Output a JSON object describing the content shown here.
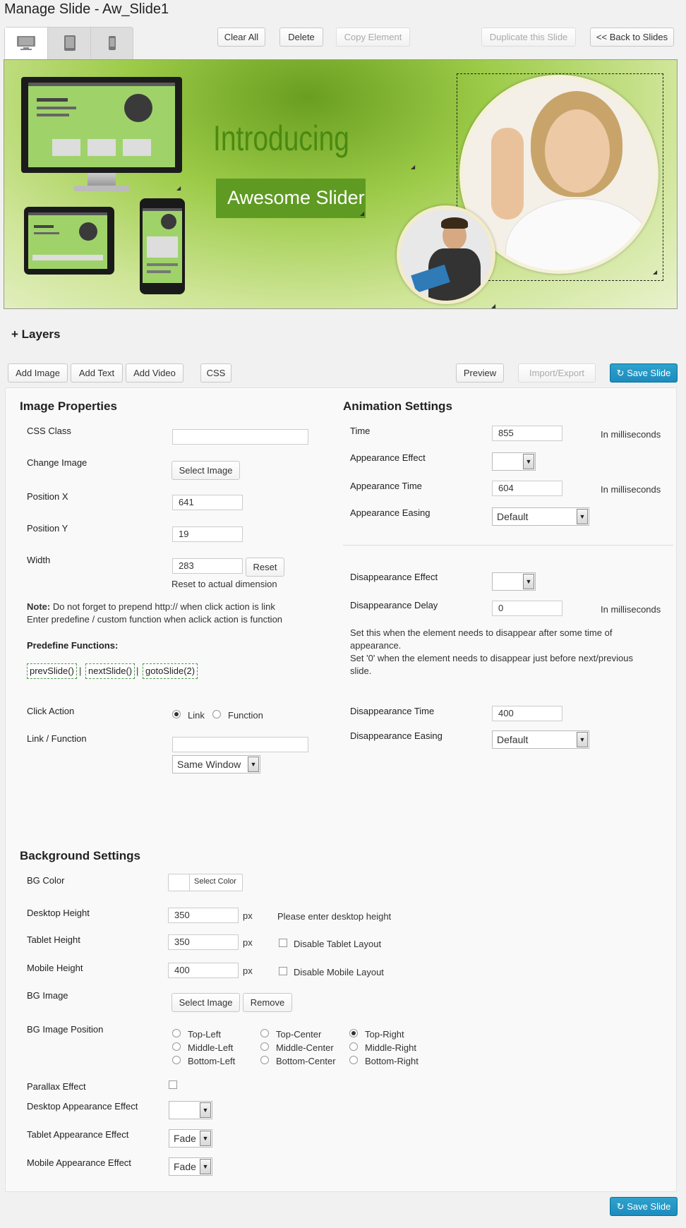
{
  "page_title": "Manage Slide - Aw_Slide1",
  "toolbar": {
    "clear_all": "Clear All",
    "delete": "Delete",
    "copy_element": "Copy Element",
    "duplicate": "Duplicate this Slide",
    "back": "<< Back to Slides"
  },
  "device_tabs": [
    "desktop-icon",
    "tablet-icon",
    "mobile-icon"
  ],
  "slide": {
    "heading": "Introducing",
    "subheading": "Awesome Slider"
  },
  "layers": {
    "toggle": "+ Layers",
    "add_image": "Add Image",
    "add_text": "Add Text",
    "add_video": "Add Video",
    "css": "CSS",
    "preview": "Preview",
    "import_export": "Import/Export",
    "save_slide": "Save Slide"
  },
  "image_props": {
    "title": "Image Properties",
    "css_class_label": "CSS Class",
    "css_class_value": "",
    "change_image_label": "Change Image",
    "select_image": "Select Image",
    "pos_x_label": "Position X",
    "pos_x_value": "641",
    "pos_y_label": "Position Y",
    "pos_y_value": "19",
    "width_label": "Width",
    "width_value": "283",
    "reset": "Reset",
    "reset_note": "Reset to actual dimension",
    "note_bold": "Note:",
    "note_line1": " Do not forget to prepend http:// when click action is link",
    "note_line2": "Enter predefine / custom function when aclick action is function",
    "predefine_label": "Predefine Functions:",
    "functions": [
      "prevSlide()",
      "nextSlide()",
      "gotoSlide(2)"
    ],
    "sep": "|",
    "click_action_label": "Click Action",
    "link_option": "Link",
    "function_option": "Function",
    "link_function_label": "Link / Function",
    "link_value": "",
    "window_select": "Same Window"
  },
  "animation": {
    "title": "Animation Settings",
    "time_label": "Time",
    "time_value": "855",
    "ms": "In milliseconds",
    "appearance_effect_label": "Appearance Effect",
    "appearance_effect_value": "",
    "appearance_time_label": "Appearance Time",
    "appearance_time_value": "604",
    "appearance_easing_label": "Appearance Easing",
    "appearance_easing_value": "Default",
    "disappearance_effect_label": "Disappearance Effect",
    "disappearance_effect_value": "",
    "disappearance_delay_label": "Disappearance Delay",
    "disappearance_delay_value": "0",
    "delay_note_1": "Set this when the element needs to disappear after some time of",
    "delay_note_2": "appearance.",
    "delay_note_3": "Set '0' when the element needs to disappear just before next/previous",
    "delay_note_4": "slide.",
    "disappearance_time_label": "Disappearance Time",
    "disappearance_time_value": "400",
    "disappearance_easing_label": "Disappearance Easing",
    "disappearance_easing_value": "Default"
  },
  "background": {
    "title": "Background Settings",
    "bg_color_label": "BG Color",
    "select_color": "Select Color",
    "desktop_height_label": "Desktop Height",
    "desktop_height_value": "350",
    "px": "px",
    "desktop_hint": "Please enter desktop height",
    "tablet_height_label": "Tablet Height",
    "tablet_height_value": "350",
    "disable_tablet": "Disable Tablet Layout",
    "mobile_height_label": "Mobile Height",
    "mobile_height_value": "400",
    "disable_mobile": "Disable Mobile Layout",
    "bg_image_label": "BG Image",
    "select_image": "Select Image",
    "remove": "Remove",
    "bg_position_label": "BG Image Position",
    "positions": [
      "Top-Left",
      "Top-Center",
      "Top-Right",
      "Middle-Left",
      "Middle-Center",
      "Middle-Right",
      "Bottom-Left",
      "Bottom-Center",
      "Bottom-Right"
    ],
    "selected_position": "Top-Right",
    "parallax_label": "Parallax Effect",
    "desktop_effect_label": "Desktop Appearance Effect",
    "desktop_effect_value": "",
    "tablet_effect_label": "Tablet Appearance Effect",
    "tablet_effect_value": "Fade",
    "mobile_effect_label": "Mobile Appearance Effect",
    "mobile_effect_value": "Fade"
  },
  "footer": {
    "save_slide": "Save Slide"
  },
  "colors": {
    "primary": "#1e8cbe",
    "slide_green": "#8fc43a",
    "title_green": "#4a8a12"
  }
}
